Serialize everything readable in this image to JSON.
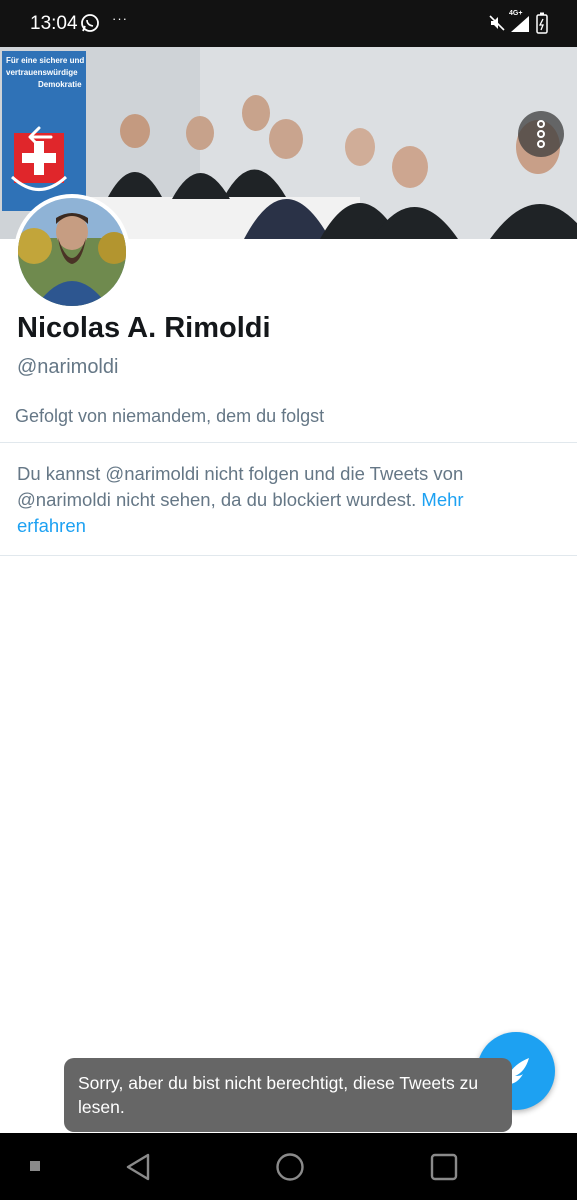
{
  "status_bar": {
    "time": "13:04",
    "notification_dots": "···",
    "network_label": "4G+",
    "icons": [
      "whatsapp-icon",
      "mute-icon",
      "signal-icon",
      "battery-icon"
    ]
  },
  "banner": {
    "sign_text_line1": "Für eine sichere und",
    "sign_text_line2": "vertrauenswürdige",
    "sign_text_line3": "Demokratie",
    "icons": [
      "back-arrow-icon",
      "more-vertical-icon"
    ]
  },
  "profile": {
    "display_name": "Nicolas A. Rimoldi",
    "handle": "@narimoldi",
    "followed_by": "Gefolgt von niemandem, dem du folgst"
  },
  "blocked": {
    "message": "Du kannst @narimoldi nicht folgen und die Tweets von @narimoldi nicht sehen, da du blockiert wurdest. ",
    "learn_more": "Mehr erfahren"
  },
  "toast": {
    "message": "Sorry, aber du bist nicht berechtigt, diese Tweets zu lesen."
  },
  "colors": {
    "accent": "#1da1f2",
    "text_primary": "#14171a",
    "text_secondary": "#657786",
    "toast_bg": "#666666"
  },
  "nav_bar": {
    "icons": [
      "recents-square-small-icon",
      "back-triangle-icon",
      "home-circle-icon",
      "overview-square-icon"
    ]
  }
}
